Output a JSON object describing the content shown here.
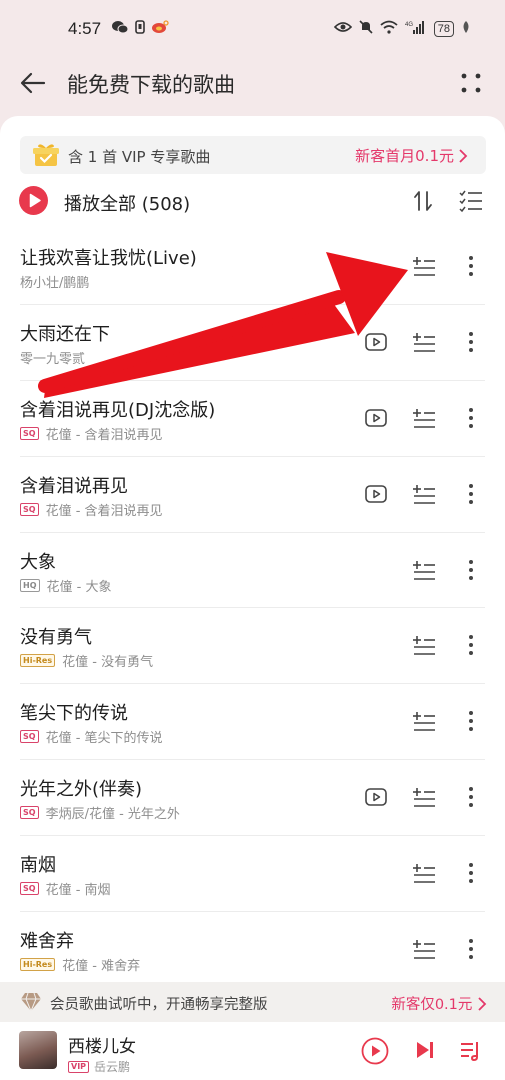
{
  "status_bar": {
    "time": "4:57",
    "battery": "78",
    "network": "4G"
  },
  "header": {
    "title": "能免费下载的歌曲"
  },
  "vip_banner": {
    "text": "含 1 首 VIP 专享歌曲",
    "promo": "新客首月0.1元"
  },
  "play_all": {
    "label": "播放全部 (508)"
  },
  "songs": [
    {
      "title": "让我欢喜让我忧(Live)",
      "subtitle": "杨小壮/鹏鹏",
      "quality": "",
      "has_mv": false
    },
    {
      "title": "大雨还在下",
      "subtitle": "零一九零贰",
      "quality": "",
      "has_mv": true
    },
    {
      "title": "含着泪说再见(DJ沈念版)",
      "subtitle": "花僮 - 含着泪说再见",
      "quality": "SQ",
      "has_mv": true
    },
    {
      "title": "含着泪说再见",
      "subtitle": "花僮 - 含着泪说再见",
      "quality": "SQ",
      "has_mv": true
    },
    {
      "title": "大象",
      "subtitle": "花僮 - 大象",
      "quality": "HQ",
      "has_mv": false
    },
    {
      "title": "没有勇气",
      "subtitle": "花僮 - 没有勇气",
      "quality": "Hi-Res",
      "has_mv": false
    },
    {
      "title": "笔尖下的传说",
      "subtitle": "花僮 - 笔尖下的传说",
      "quality": "SQ",
      "has_mv": false
    },
    {
      "title": "光年之外(伴奏)",
      "subtitle": "李炳辰/花僮 - 光年之外",
      "quality": "SQ",
      "has_mv": true
    },
    {
      "title": "南烟",
      "subtitle": "花僮 - 南烟",
      "quality": "SQ",
      "has_mv": false
    },
    {
      "title": "难舍弃",
      "subtitle": "花僮 - 难舍弃",
      "quality": "Hi-Res",
      "has_mv": false
    }
  ],
  "trial_banner": {
    "text": "会员歌曲试听中，开通畅享完整版",
    "promo": "新客仅0.1元"
  },
  "player": {
    "title": "西楼儿女",
    "vip_tag": "VIP",
    "artist": "岳云鹏"
  },
  "colors": {
    "accent": "#e8394d",
    "promo": "#e4386a",
    "header_bg": "#f4e9ea",
    "annotation": "#e8141c"
  }
}
